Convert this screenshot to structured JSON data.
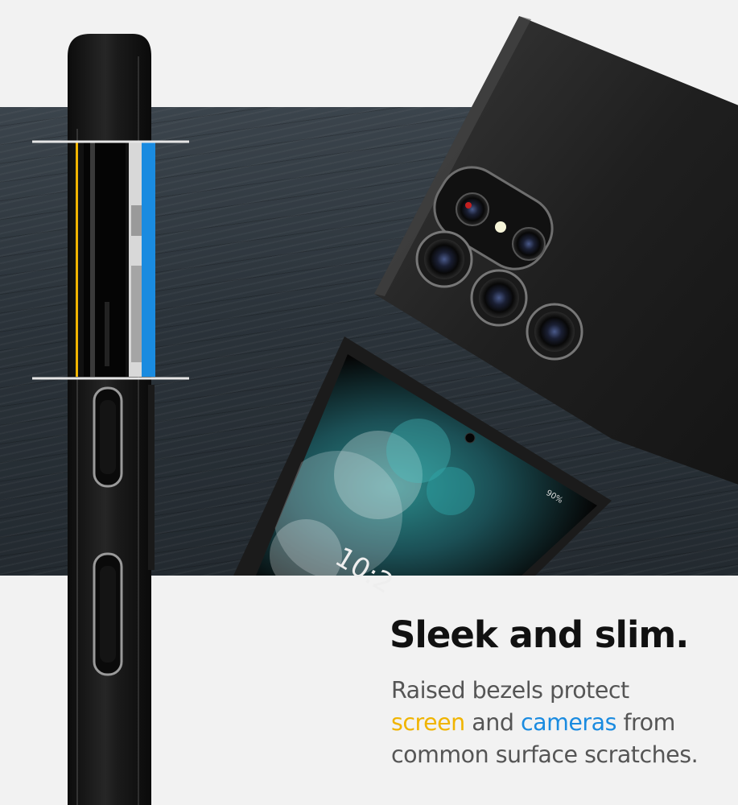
{
  "headline": "Sleek and slim.",
  "body": {
    "line1": "Raised bezels protect",
    "line2_highlight_1": "screen",
    "line2_mid": " and ",
    "line2_highlight_2": "cameras",
    "line2_end": " from",
    "line3": "common surface scratches."
  },
  "phone_screen": {
    "battery": "90%",
    "clock": "10:2"
  },
  "colors": {
    "screen_accent": "#f0b400",
    "camera_accent": "#1a8be0",
    "background": "#f2f2f2",
    "case": "#1c1c1c"
  }
}
